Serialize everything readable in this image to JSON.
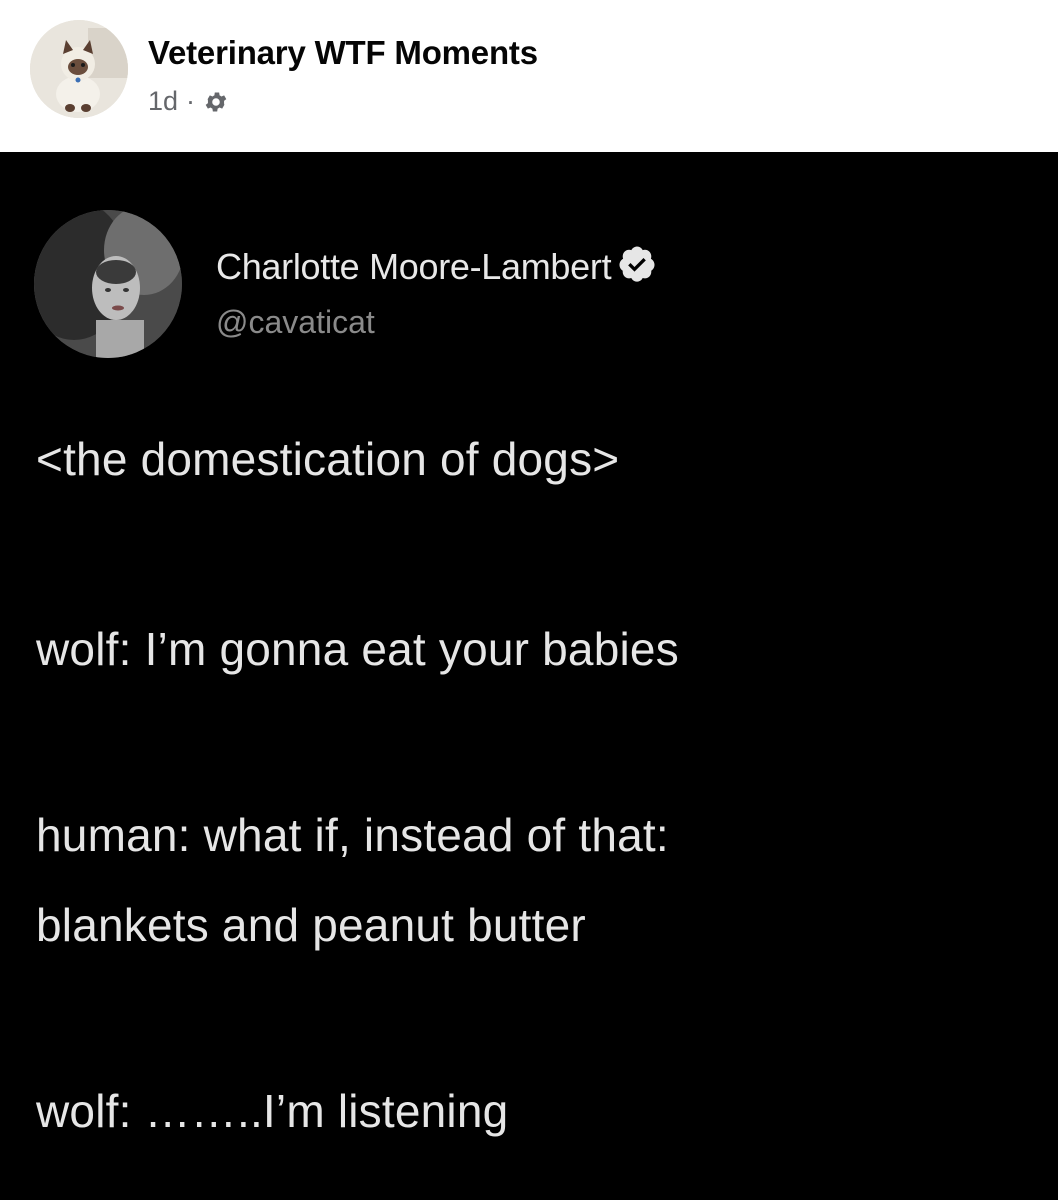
{
  "post": {
    "page_name": "Veterinary WTF Moments",
    "time": "1d",
    "separator": "·",
    "audience_icon": "gear-icon"
  },
  "tweet": {
    "author_name": "Charlotte Moore-Lambert",
    "handle": "@cavaticat",
    "verified_icon": "verified-badge-icon",
    "lines": [
      "<the domestication of dogs>",
      "wolf: I’m gonna eat your babies",
      "human: what if, instead of that:",
      "blankets and peanut butter",
      "wolf: ……..I’m listening"
    ]
  },
  "colors": {
    "background_header": "#ffffff",
    "background_image": "#000000",
    "tweet_text": "#e6e6e6",
    "handle_text": "#8a8a8a"
  }
}
